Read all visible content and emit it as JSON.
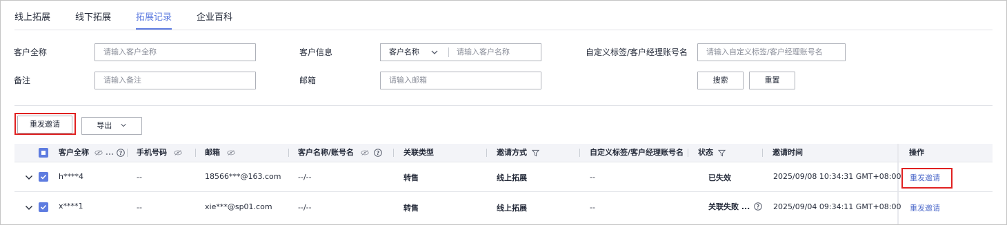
{
  "tabs": [
    {
      "label": "线上拓展",
      "active": false
    },
    {
      "label": "线下拓展",
      "active": false
    },
    {
      "label": "拓展记录",
      "active": true
    },
    {
      "label": "企业百科",
      "active": false
    }
  ],
  "filters": {
    "customer_full_name": {
      "label": "客户全称",
      "placeholder": "请输入客户全称"
    },
    "customer_info": {
      "label": "客户信息",
      "select_value": "客户名称",
      "placeholder": "请输入客户名称"
    },
    "custom_tag": {
      "label": "自定义标签/客户经理账号名",
      "placeholder": "请输入自定义标签/客户经理账号名"
    },
    "remark": {
      "label": "备注",
      "placeholder": "请输入备注"
    },
    "email": {
      "label": "邮箱",
      "placeholder": "请输入邮箱"
    },
    "search_label": "搜索",
    "reset_label": "重置"
  },
  "actions": {
    "resend_label": "重发邀请",
    "export_label": "导出"
  },
  "table": {
    "columns": [
      "客户全称",
      "手机号码",
      "邮箱",
      "客户名称/账号名",
      "关联类型",
      "邀请方式",
      "自定义标签/客户经理账号名",
      "状态",
      "邀请时间",
      "操作"
    ],
    "rows": [
      {
        "name": "h****4",
        "phone": "--",
        "email": "18566***@163.com",
        "account": "--/--",
        "relation": "转售",
        "method": "线上拓展",
        "tag": "--",
        "status": "已失效",
        "time": "2025/09/08 10:34:31 GMT+08:00",
        "op": "重发邀请"
      },
      {
        "name": "x****1",
        "phone": "--",
        "email": "xie***@sp01.com",
        "account": "--/--",
        "relation": "转售",
        "method": "线上拓展",
        "tag": "--",
        "status": "关联失败 ...",
        "time": "2025/09/04 09:34:11 GMT+08:00",
        "op": "重发邀请"
      }
    ]
  },
  "colors": {
    "accent": "#5e7ce0",
    "link": "#526ecc",
    "highlight": "#e02020"
  }
}
